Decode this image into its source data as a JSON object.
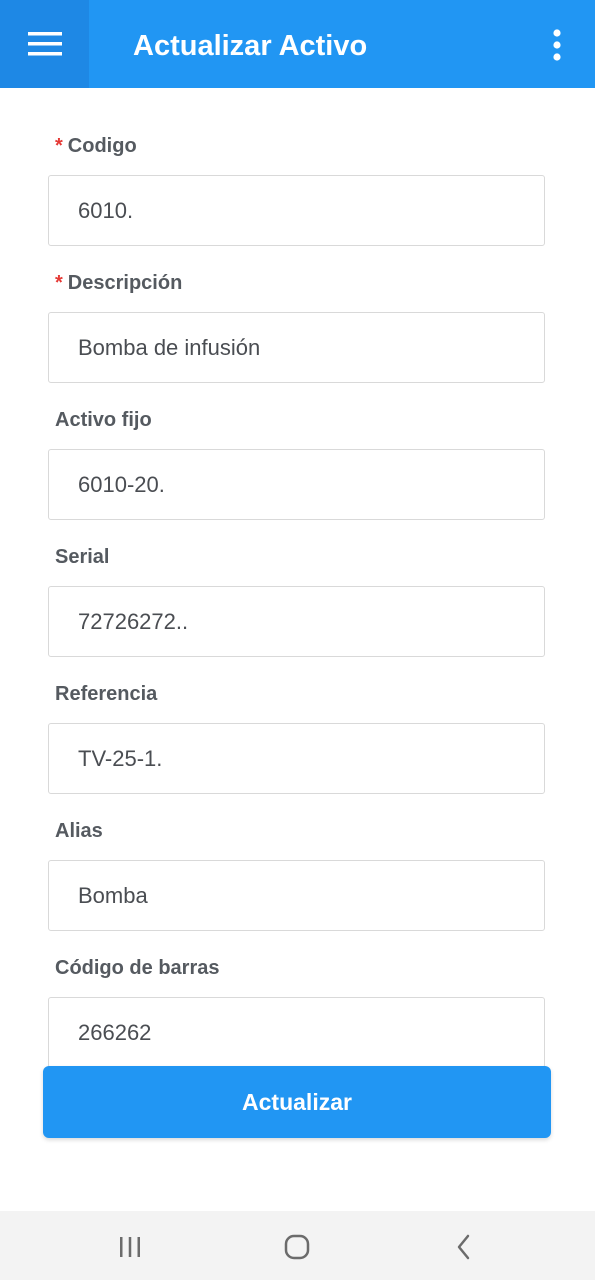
{
  "appbar": {
    "title": "Actualizar Activo",
    "menu_icon": "hamburger-menu-icon",
    "more_icon": "more-vertical-icon"
  },
  "form": {
    "fields": [
      {
        "label": "Codigo",
        "required": true,
        "value": "6010."
      },
      {
        "label": "Descripción",
        "required": true,
        "value": "Bomba de infusión"
      },
      {
        "label": "Activo fijo",
        "required": false,
        "value": "6010-20."
      },
      {
        "label": "Serial",
        "required": false,
        "value": "72726272.."
      },
      {
        "label": "Referencia",
        "required": false,
        "value": "TV-25-1."
      },
      {
        "label": "Alias",
        "required": false,
        "value": "Bomba"
      },
      {
        "label": "Código de barras",
        "required": false,
        "value": "266262"
      }
    ],
    "required_marker": "*",
    "submit_label": "Actualizar"
  },
  "navbar": {
    "recents_icon": "recent-apps-icon",
    "home_icon": "home-icon",
    "back_icon": "back-chevron-icon"
  },
  "colors": {
    "primary": "#2196f3",
    "primary_dark": "#1e88e5",
    "required": "#e53935",
    "label": "#555a60"
  }
}
